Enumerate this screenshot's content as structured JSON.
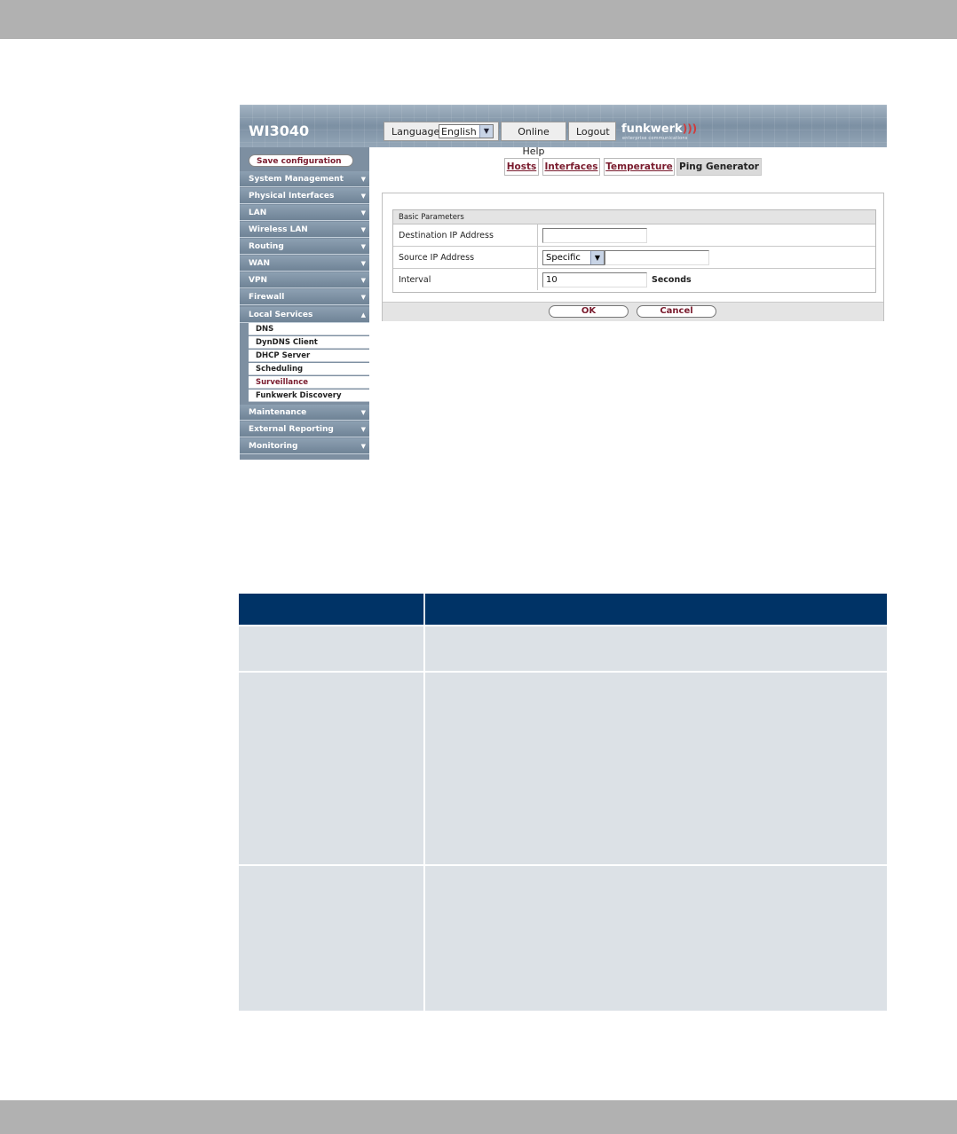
{
  "header": {
    "product": "WI3040",
    "language_label": "Language",
    "language_value": "English",
    "online_help": "Online Help",
    "logout": "Logout",
    "logo": "funkwerk",
    "logo_sub": "enterprise communications"
  },
  "sidebar": {
    "save_config": "Save configuration",
    "items": [
      {
        "label": "System Management"
      },
      {
        "label": "Physical Interfaces"
      },
      {
        "label": "LAN"
      },
      {
        "label": "Wireless LAN"
      },
      {
        "label": "Routing"
      },
      {
        "label": "WAN"
      },
      {
        "label": "VPN"
      },
      {
        "label": "Firewall"
      },
      {
        "label": "Local Services"
      },
      {
        "label": "Maintenance"
      },
      {
        "label": "External Reporting"
      },
      {
        "label": "Monitoring"
      }
    ],
    "subitems": [
      {
        "label": "DNS"
      },
      {
        "label": "DynDNS Client"
      },
      {
        "label": "DHCP Server"
      },
      {
        "label": "Scheduling"
      },
      {
        "label": "Surveillance"
      },
      {
        "label": "Funkwerk Discovery"
      }
    ]
  },
  "tabs": [
    {
      "label": "Hosts"
    },
    {
      "label": "Interfaces"
    },
    {
      "label": "Temperature"
    },
    {
      "label": "Ping Generator"
    }
  ],
  "form": {
    "section_title": "Basic Parameters",
    "fields": [
      {
        "label": "Destination IP Address",
        "value": ""
      },
      {
        "label": "Source IP Address",
        "select_value": "Specific",
        "value": ""
      },
      {
        "label": "Interval",
        "value": "10",
        "unit": "Seconds"
      }
    ],
    "ok": "OK",
    "cancel": "Cancel"
  },
  "colors": {
    "table_header": "#003366",
    "table_row": "#dce1e6",
    "accent_link": "#7a1c2e"
  }
}
